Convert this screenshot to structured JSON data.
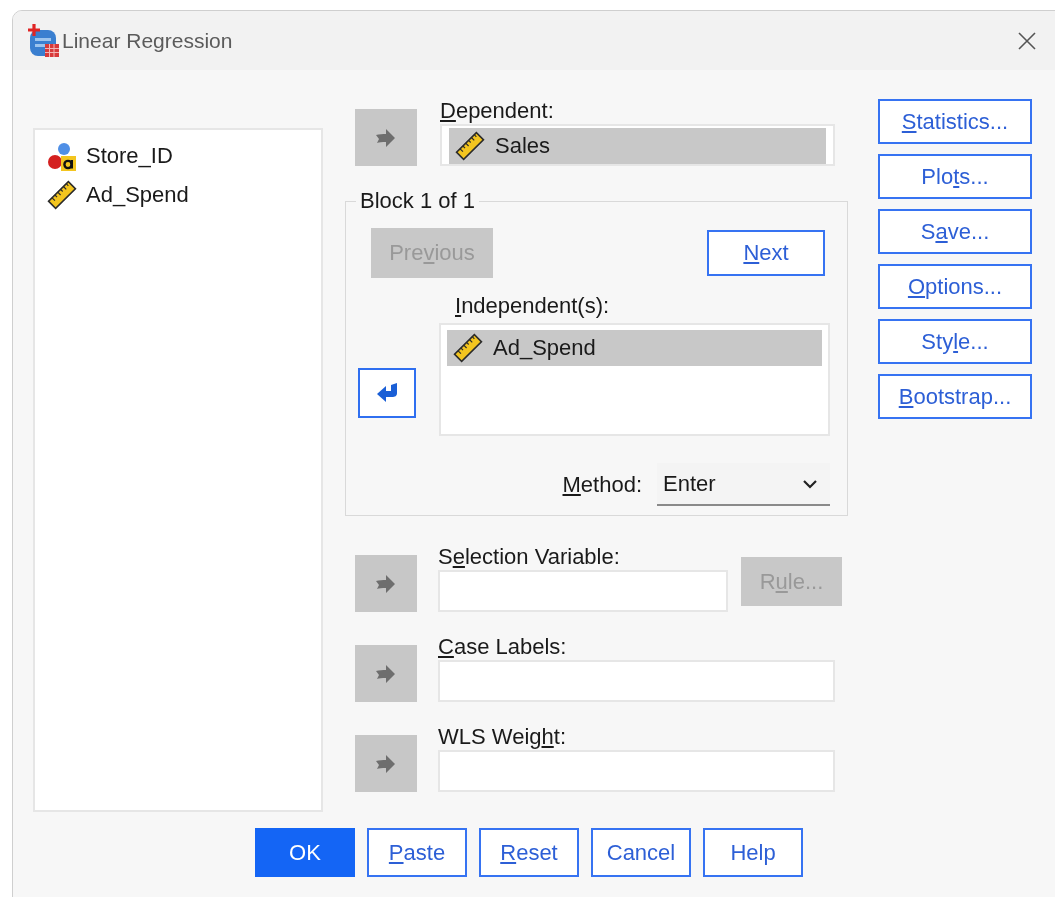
{
  "window": {
    "title": "Linear Regression"
  },
  "source_variables": [
    {
      "name": "Store_ID",
      "kind": "nominal",
      "selected": false
    },
    {
      "name": "Ad_Spend",
      "kind": "scale",
      "selected": false
    }
  ],
  "dependent": {
    "label": {
      "key": "D",
      "after": "ependent:"
    },
    "arrow": {
      "kind": "right",
      "active": false
    },
    "variables": [
      {
        "name": "Sales",
        "kind": "scale",
        "selected": true
      }
    ]
  },
  "block": {
    "title": "Block 1 of 1",
    "previous": {
      "label": {
        "before": "Pre",
        "key": "v",
        "after": "ious"
      },
      "disabled": true
    },
    "next": {
      "label": {
        "key": "N",
        "after": "ext"
      },
      "disabled": false
    },
    "independents": {
      "label": {
        "key": "I",
        "after": "ndependent(s):"
      },
      "arrow": {
        "kind": "left",
        "active": true
      },
      "variables": [
        {
          "name": "Ad_Spend",
          "kind": "scale",
          "selected": true
        }
      ]
    },
    "method": {
      "label": {
        "key": "M",
        "after": "ethod:"
      },
      "value": "Enter"
    }
  },
  "selection_variable": {
    "label": {
      "before": "S",
      "key": "e",
      "after": "lection Variable:"
    },
    "arrow": {
      "kind": "right",
      "active": false
    },
    "rule": {
      "label": {
        "before": "R",
        "key": "u",
        "after": "le..."
      },
      "disabled": true
    }
  },
  "case_labels": {
    "label": {
      "key": "C",
      "after": "ase Labels:"
    },
    "arrow": {
      "kind": "right",
      "active": false
    }
  },
  "wls_weight": {
    "label": {
      "before": "WLS Weig",
      "key": "h",
      "after": "t:"
    },
    "arrow": {
      "kind": "right",
      "active": false
    }
  },
  "side_buttons": [
    {
      "label": {
        "key": "S",
        "after": "tatistics..."
      }
    },
    {
      "label": {
        "before": "Plo",
        "key": "t",
        "after": "s..."
      }
    },
    {
      "label": {
        "before": "S",
        "key": "a",
        "after": "ve..."
      }
    },
    {
      "label": {
        "key": "O",
        "after": "ptions..."
      }
    },
    {
      "label": {
        "before": "Sty",
        "key": "l",
        "after": "e..."
      }
    },
    {
      "label": {
        "key": "B",
        "after": "ootstrap..."
      }
    }
  ],
  "bottom_buttons": [
    {
      "label": {
        "before": "OK"
      },
      "default": true
    },
    {
      "label": {
        "key": "P",
        "after": "aste"
      },
      "default": false
    },
    {
      "label": {
        "key": "R",
        "after": "eset"
      },
      "default": false
    },
    {
      "label": {
        "before": "Cancel"
      },
      "default": false
    },
    {
      "label": {
        "before": "Help"
      },
      "default": false
    }
  ]
}
